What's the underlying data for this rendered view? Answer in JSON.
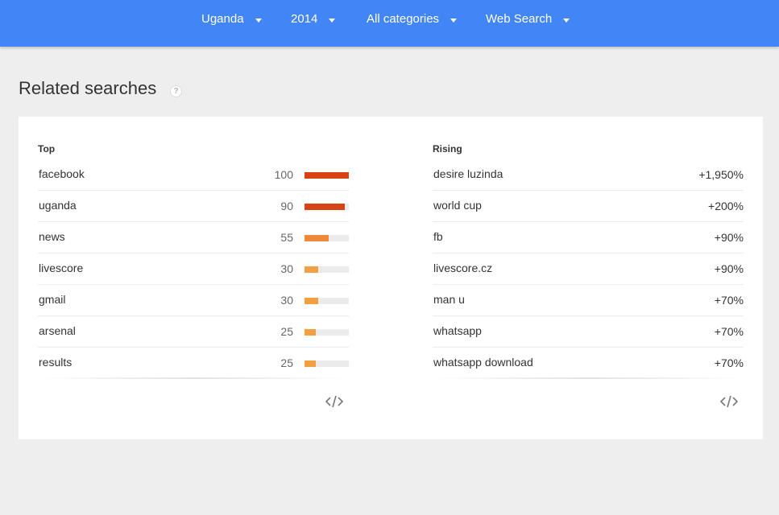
{
  "filters": {
    "country": "Uganda",
    "year": "2014",
    "category": "All categories",
    "source": "Web Search"
  },
  "section": {
    "title": "Related searches",
    "help_glyph": "?"
  },
  "top": {
    "heading": "Top",
    "rows": [
      {
        "term": "facebook",
        "value": "100",
        "level": 100,
        "color": "#d84315"
      },
      {
        "term": "uganda",
        "value": "90",
        "level": 90,
        "color": "#d84315"
      },
      {
        "term": "news",
        "value": "55",
        "level": 55,
        "color": "#ef8a3c"
      },
      {
        "term": "livescore",
        "value": "30",
        "level": 30,
        "color": "#f3a043"
      },
      {
        "term": "gmail",
        "value": "30",
        "level": 30,
        "color": "#f3a043"
      },
      {
        "term": "arsenal",
        "value": "25",
        "level": 25,
        "color": "#f3a043"
      },
      {
        "term": "results",
        "value": "25",
        "level": 25,
        "color": "#f3a043"
      }
    ]
  },
  "rising": {
    "heading": "Rising",
    "rows": [
      {
        "term": "desire luzinda",
        "value": "+1,950%"
      },
      {
        "term": "world cup",
        "value": "+200%"
      },
      {
        "term": "fb",
        "value": "+90%"
      },
      {
        "term": "livescore.cz",
        "value": "+90%"
      },
      {
        "term": "man u",
        "value": "+70%"
      },
      {
        "term": "whatsapp",
        "value": "+70%"
      },
      {
        "term": "whatsapp download",
        "value": "+70%"
      }
    ]
  },
  "icons": {
    "caret": "caret-down-icon",
    "help": "help-icon",
    "embed": "code-embed-icon"
  }
}
